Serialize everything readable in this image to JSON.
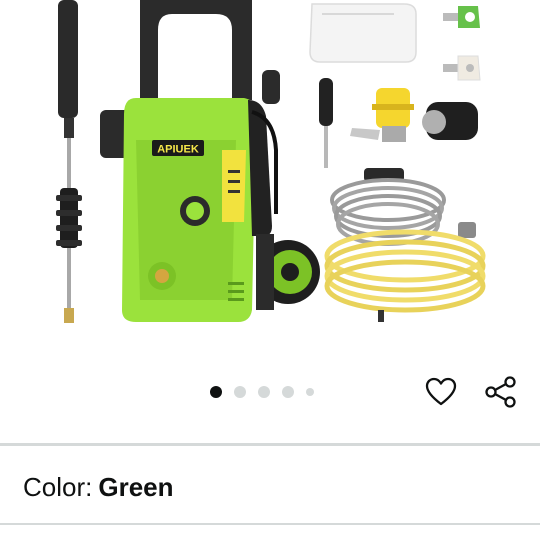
{
  "product": {
    "brand_label": "APIUEK",
    "image_alt": "Electric pressure washer with spray wand, nozzles, hose and accessories"
  },
  "carousel": {
    "total_images": 5,
    "active_index": 0
  },
  "actions": {
    "favorite_icon": "heart-outline-icon",
    "share_icon": "share-icon"
  },
  "variant": {
    "label": "Color:",
    "value": "Green"
  },
  "colors": {
    "accent_green": "#9be23c",
    "dark_body": "#2b2b2b",
    "yellow": "#f5e64a",
    "dot_active": "#0f1111",
    "dot_inactive": "#d5d9d9"
  }
}
